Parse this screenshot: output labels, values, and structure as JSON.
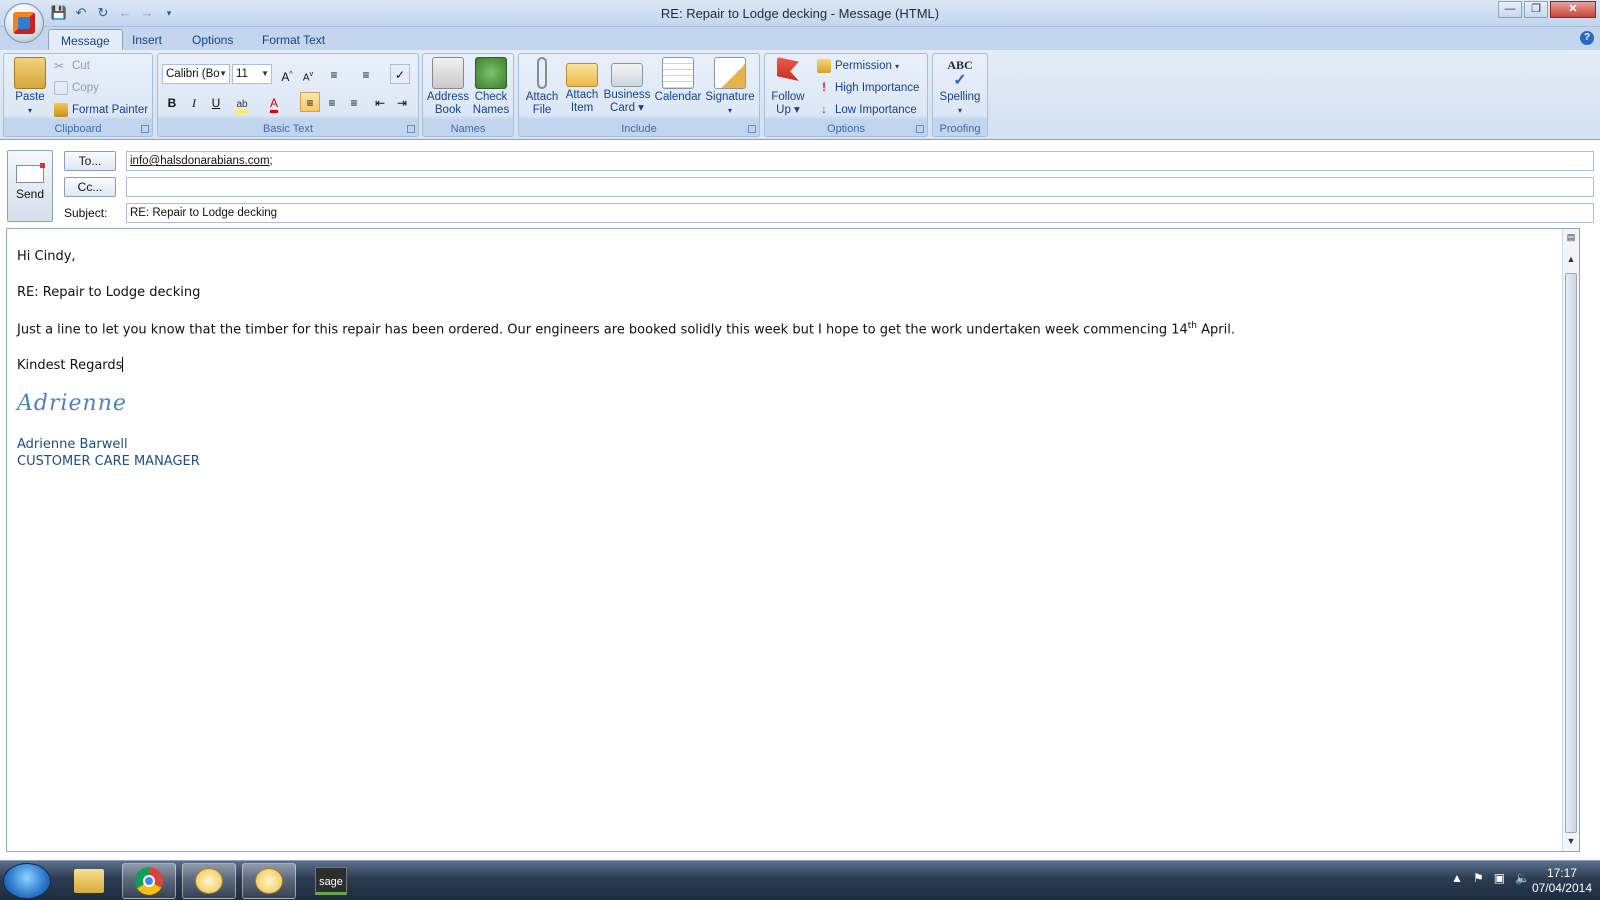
{
  "window": {
    "title": "RE: Repair to Lodge decking - Message (HTML)"
  },
  "quick_access": {
    "icons": [
      "save-icon",
      "undo-icon",
      "redo-icon",
      "back-icon",
      "forward-icon",
      "customize-icon"
    ]
  },
  "tabs": [
    "Message",
    "Insert",
    "Options",
    "Format Text"
  ],
  "ribbon": {
    "clipboard": {
      "label": "Clipboard",
      "paste": "Paste",
      "cut": "Cut",
      "copy": "Copy",
      "format_painter": "Format Painter"
    },
    "basic_text": {
      "label": "Basic Text",
      "font": "Calibri (Bo",
      "size": "11"
    },
    "names": {
      "label": "Names",
      "address_book": [
        "Address",
        "Book"
      ],
      "check_names": [
        "Check",
        "Names"
      ]
    },
    "include": {
      "label": "Include",
      "attach_file": [
        "Attach",
        "File"
      ],
      "attach_item": [
        "Attach",
        "Item"
      ],
      "business_card": [
        "Business",
        "Card"
      ],
      "calendar": "Calendar",
      "signature": "Signature"
    },
    "options": {
      "label": "Options",
      "follow_up": [
        "Follow",
        "Up"
      ],
      "permission": "Permission",
      "high_importance": "High Importance",
      "low_importance": "Low Importance"
    },
    "proofing": {
      "label": "Proofing",
      "spelling": "Spelling",
      "spelling_icon_text": "ABC"
    }
  },
  "header": {
    "send": "Send",
    "to_button": "To...",
    "cc_button": "Cc...",
    "subject_label": "Subject:",
    "to_value": "info@halsdonarabians.com",
    "to_suffix": ";",
    "cc_value": "",
    "subject_value": "RE: Repair to Lodge decking"
  },
  "body": {
    "greeting": "Hi Cindy,",
    "re_line": "RE: Repair to Lodge decking",
    "para_before": "Just a line to let you know that the timber for this repair has been ordered.  Our engineers are booked solidly this week but I hope to get the work undertaken week commencing 14",
    "para_sup": "th",
    "para_after": " April.",
    "closing": "Kindest Regards",
    "signature_script": "Adrienne",
    "sig_name": "Adrienne Barwell",
    "sig_title": "CUSTOMER CARE MANAGER"
  },
  "taskbar": {
    "time": "17:17",
    "date": "07/04/2014",
    "sage_label": "sage"
  },
  "colors": {
    "ribbon_bg": "#dce7f5",
    "tab_text": "#15428b",
    "signature": "#4f81bd",
    "sig_text": "#1f4e79",
    "taskbar": "#2c3c52"
  }
}
